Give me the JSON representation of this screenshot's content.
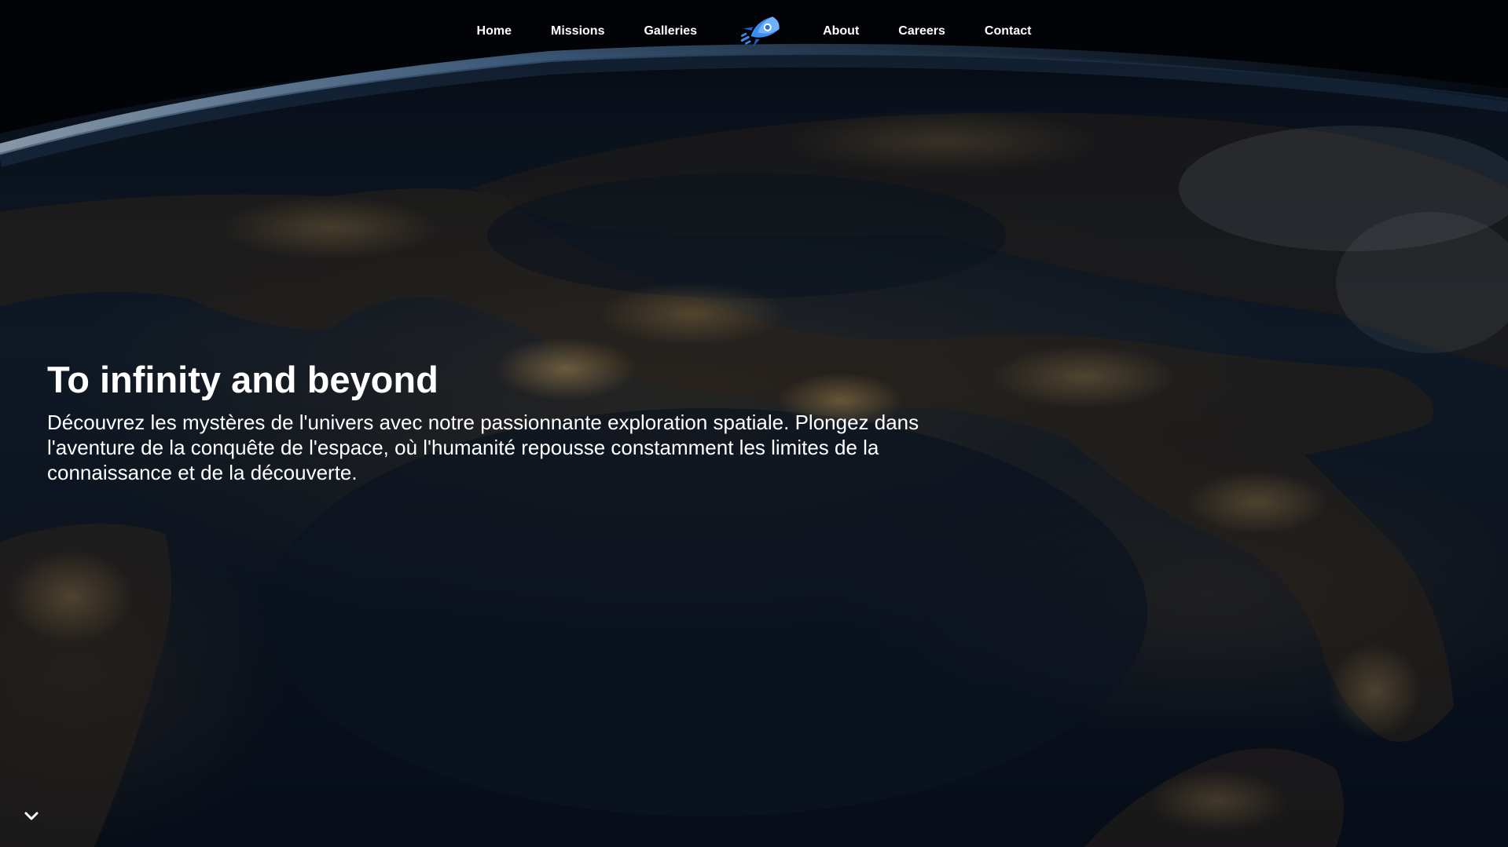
{
  "nav": {
    "left_items": [
      {
        "label": "Home"
      },
      {
        "label": "Missions"
      },
      {
        "label": "Galleries"
      }
    ],
    "logo_icon": "rocket-icon",
    "right_items": [
      {
        "label": "About"
      },
      {
        "label": "Careers"
      },
      {
        "label": "Contact"
      }
    ]
  },
  "hero": {
    "title": "To infinity and beyond",
    "text": "Découvrez les mystères de l'univers avec notre passionnante exploration spatiale. Plongez dans l'aventure de la conquête de l'espace, où l'humanité repousse constamment les limites de la connaissance et de la découverte.",
    "background": "earth-at-night-image",
    "scroll_icon": "chevron-down-icon"
  },
  "colors": {
    "text": "#ffffff",
    "logo_blue": "#3b8df0",
    "atmosphere": "#7fb6e6"
  }
}
